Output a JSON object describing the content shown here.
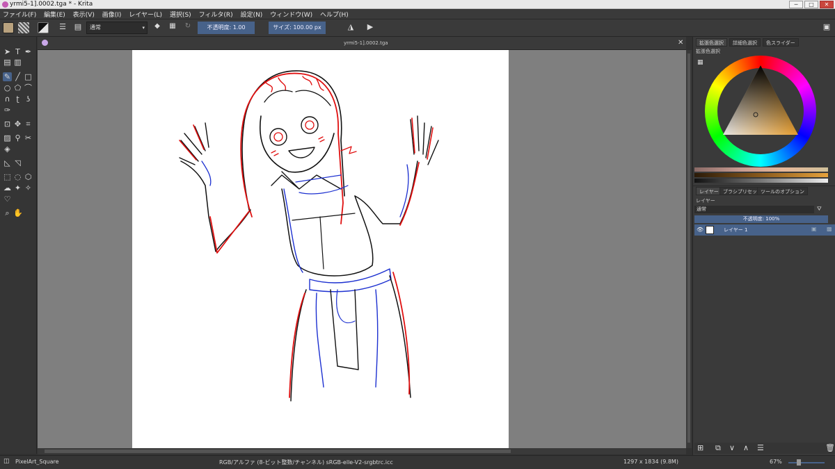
{
  "window": {
    "title": "yrmi5-1].0002.tga * - Krita",
    "buttons": [
      "─",
      "□",
      "✕"
    ]
  },
  "menu": [
    "ファイル(F)",
    "編集(E)",
    "表示(V)",
    "画像(I)",
    "レイヤー(L)",
    "選択(S)",
    "フィルタ(R)",
    "設定(N)",
    "ウィンドウ(W)",
    "ヘルプ(H)"
  ],
  "toolbar": {
    "blend_mode": "通常",
    "opacity_label": "不透明度:",
    "opacity_value": "1.00",
    "size_label": "サイズ:",
    "size_value": "100.00 px"
  },
  "document": {
    "tab_title": "yrmi5-1].0002.tga",
    "close": "✕"
  },
  "dock": {
    "color_tabs": [
      "拡張色選択",
      "詳細色選択",
      "色スライダー"
    ],
    "color_panel_title": "拡張色選択",
    "layer_tabs": [
      "レイヤー",
      "ブラシプリセット",
      "ツールのオプション"
    ],
    "layer_panel_title": "レイヤー",
    "layer_blend": "通常",
    "layer_opacity": "不透明度: 100%",
    "layers": [
      {
        "name": "レイヤー 1",
        "visible": true
      }
    ]
  },
  "status": {
    "brush": "PixelArt_Square",
    "color_space": "RGB/アルファ (8-ビット整数/チャンネル)  sRGB-elle-V2-srgbtrc.icc",
    "dimensions": "1297 x 1834 (9.8M)",
    "zoom": "67%"
  },
  "colors": {
    "accent": "#47628a",
    "canvas_bg": "#7f7f7f",
    "line_red": "#e01010",
    "line_blue": "#1b2fd0"
  },
  "icons": [
    "freehand-brush-icon",
    "text-icon",
    "calligraphy-icon",
    "line-icon",
    "rectangle-icon",
    "ellipse-icon",
    "polygon-icon",
    "polyline-icon",
    "bezier-icon",
    "move-icon",
    "crop-icon",
    "gradient-icon",
    "color-picker-icon",
    "fill-icon",
    "measure-icon",
    "rect-select-icon",
    "ellipse-select-icon",
    "magic-wand-icon",
    "zoom-icon",
    "pan-icon"
  ]
}
